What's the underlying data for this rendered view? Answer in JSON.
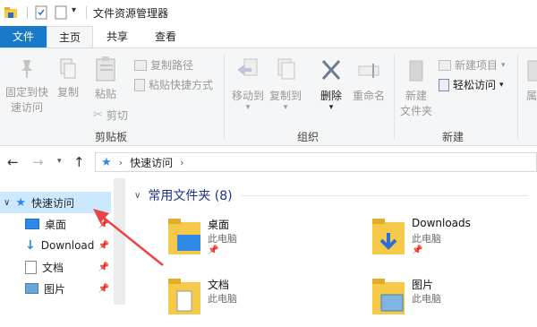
{
  "window": {
    "title": "文件资源管理器"
  },
  "tabs": {
    "file": "文件",
    "home": "主页",
    "share": "共享",
    "view": "查看"
  },
  "ribbon": {
    "pin_quick_access_line1": "固定到快",
    "pin_quick_access_line2": "速访问",
    "copy": "复制",
    "paste": "粘贴",
    "copy_path": "复制路径",
    "paste_shortcut": "粘贴快捷方式",
    "cut": "剪切",
    "clipboard_group": "剪贴板",
    "move_to": "移动到",
    "copy_to": "复制到",
    "delete": "删除",
    "rename": "重命名",
    "organize_group": "组织",
    "new_folder_line1": "新建",
    "new_folder_line2": "文件夹",
    "new_item": "新建项目",
    "easy_access": "轻松访问",
    "new_group": "新建",
    "properties_partial": "属"
  },
  "address": {
    "location": "快速访问"
  },
  "nav": {
    "quick_access": "快速访问",
    "items": [
      {
        "label": "桌面"
      },
      {
        "label": "Download"
      },
      {
        "label": "文档"
      },
      {
        "label": "图片"
      }
    ]
  },
  "content": {
    "group_title": "常用文件夹 (8)",
    "tiles": [
      {
        "name": "桌面",
        "sub": "此电脑"
      },
      {
        "name": "Downloads",
        "sub": "此电脑"
      },
      {
        "name": "文档",
        "sub": "此电脑"
      },
      {
        "name": "图片",
        "sub": "此电脑"
      }
    ]
  },
  "colors": {
    "accent": "#1979ca",
    "selection": "#cce8ff",
    "folder": "#f7c948",
    "annotation_arrow": "#e84545"
  }
}
